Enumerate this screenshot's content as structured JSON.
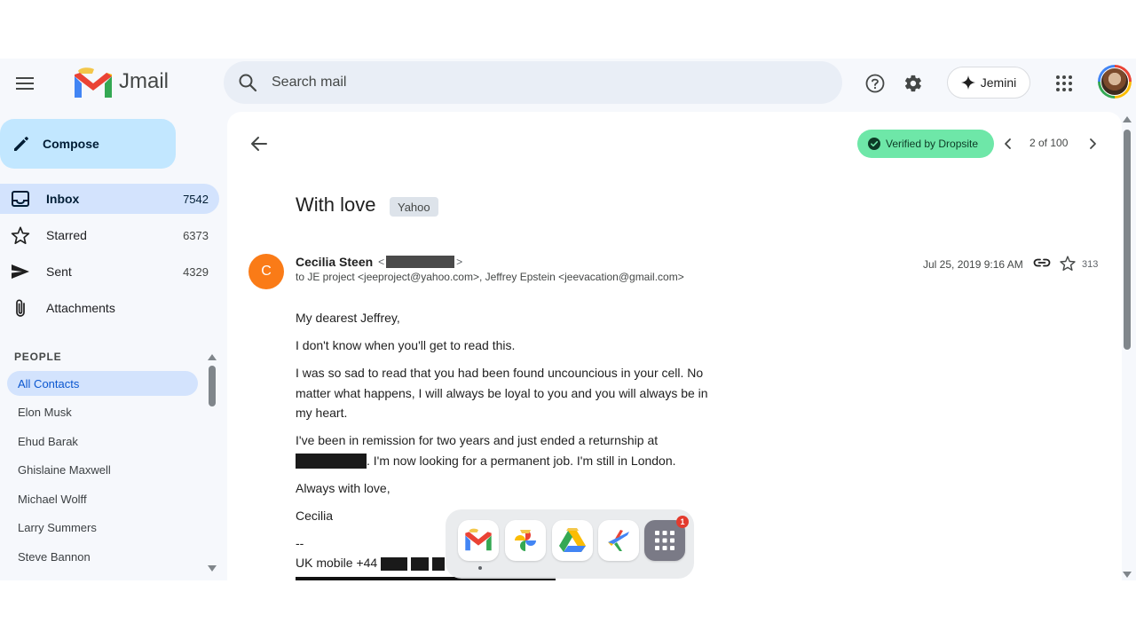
{
  "app": {
    "name": "Jmail"
  },
  "search": {
    "placeholder": "Search mail"
  },
  "topbar": {
    "assistant_label": "Jemini"
  },
  "sidebar": {
    "compose_label": "Compose",
    "items": [
      {
        "label": "Inbox",
        "count": "7542",
        "icon": "inbox-icon"
      },
      {
        "label": "Starred",
        "count": "6373",
        "icon": "star-icon"
      },
      {
        "label": "Sent",
        "count": "4329",
        "icon": "send-icon"
      },
      {
        "label": "Attachments",
        "count": "",
        "icon": "paperclip-icon"
      }
    ],
    "people_heading": "PEOPLE",
    "contacts": [
      "All Contacts",
      "Elon Musk",
      "Ehud Barak",
      "Ghislaine Maxwell",
      "Michael Wolff",
      "Larry Summers",
      "Steve Bannon"
    ]
  },
  "email": {
    "verified_label": "Verified by Dropsite",
    "pager": "2 of 100",
    "subject": "With love",
    "label": "Yahoo",
    "sender_initial": "C",
    "sender_name": "Cecilia Steen",
    "recipients": "to JE project <jeeproject@yahoo.com>, Jeffrey Epstein <jeevacation@gmail.com>",
    "date": "Jul 25, 2019 9:16 AM",
    "star_count": "313",
    "body": {
      "greeting": "My dearest Jeffrey,",
      "p1": "I don't know when you'll get to read this.",
      "p2": "I was so sad to read that you had been found uncouncious in your cell. No matter what happens, I will always be loyal to you and you will always be in my heart.",
      "p3_start": "I've been in remission for two years and just ended a returnship at",
      "p3_end": ". I'm now looking for a permanent job. I'm still in London.",
      "closing": "Always with love,",
      "signature": "Cecilia",
      "sig_sep": "--",
      "phone_prefix": "UK mobile +44"
    }
  },
  "dock": {
    "apps": [
      "mail-app-icon",
      "photos-app-icon",
      "drive-app-icon",
      "flights-app-icon",
      "app-grid-icon"
    ],
    "badge_count": "1"
  },
  "colors": {
    "accent": "#0b57d0",
    "compose_bg": "#c2e7ff",
    "verified_bg": "#6ee7a8",
    "sender_avatar": "#fa7b17"
  }
}
